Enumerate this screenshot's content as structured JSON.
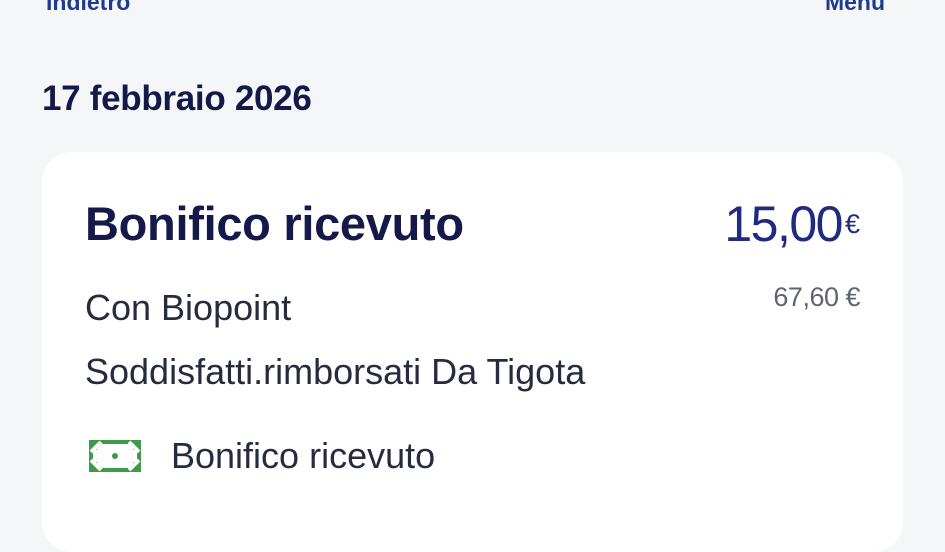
{
  "header": {
    "back_label": "Indietro",
    "menu_label": "Menu"
  },
  "date": "17 febbraio 2026",
  "transaction": {
    "title": "Bonifico ricevuto",
    "amount": "15,00",
    "currency": "€",
    "balance": "67,60 €",
    "description_line1": "Con Biopoint",
    "description_line2": "Soddisfatti.rimborsati Da Tigota",
    "type_icon": "banknote-icon",
    "type_label": "Bonifico ricevuto",
    "colors": {
      "title": "#14194a",
      "amount": "#1f2a80",
      "icon": "#3f9b4a"
    }
  }
}
